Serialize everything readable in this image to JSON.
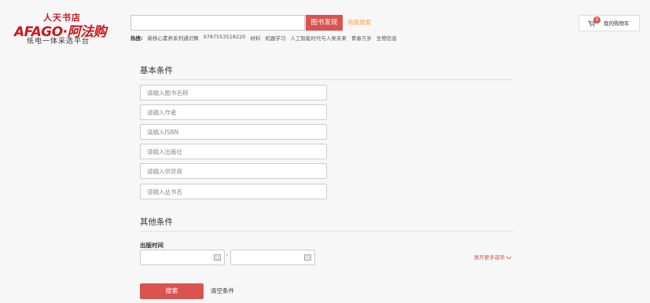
{
  "header": {
    "logo_bookstore": "人天书店",
    "logo_brand": "AFAGO·阿法购",
    "logo_tagline": "纸电一体采选平台",
    "search_button": "图书发现",
    "advanced_search": "高级搜索",
    "hot_label": "热搜:",
    "hot_terms": [
      "新核心素养系列通识舞",
      "9787553518220",
      "材料",
      "机器学习",
      "人工智能时代与人类未来",
      "青春万岁",
      "生物信息"
    ],
    "cart_count": "0",
    "cart_label": "我的购物车"
  },
  "basic": {
    "title": "基本条件",
    "fields": [
      {
        "placeholder": "请输入图书名称"
      },
      {
        "placeholder": "请输入作者"
      },
      {
        "placeholder": "请输入ISBN"
      },
      {
        "placeholder": "请输入出版社"
      },
      {
        "placeholder": "请输入供货商"
      },
      {
        "placeholder": "请输入丛书名"
      }
    ]
  },
  "other": {
    "title": "其他条件",
    "pub_time_label": "出版时间",
    "range_separator": "-",
    "more_options": "展开更多选项"
  },
  "actions": {
    "search": "搜索",
    "clear": "清空条件"
  },
  "colors": {
    "accent": "#d9534f",
    "brand": "#c8171e",
    "link": "#f0a24f"
  }
}
